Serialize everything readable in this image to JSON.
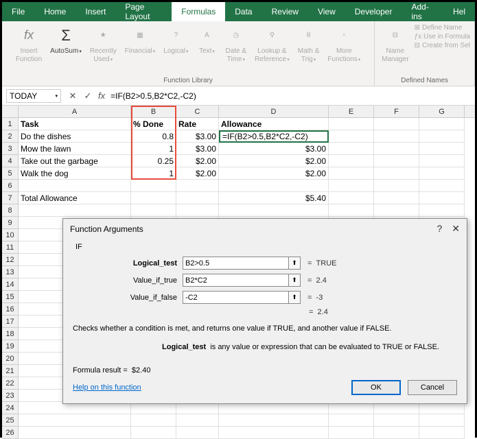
{
  "tabs": [
    "File",
    "Home",
    "Insert",
    "Page Layout",
    "Formulas",
    "Data",
    "Review",
    "View",
    "Developer",
    "Add-ins",
    "Hel"
  ],
  "active_tab": 4,
  "ribbon": {
    "insert_function": "Insert\nFunction",
    "autosum": "AutoSum",
    "recently": "Recently\nUsed",
    "financial": "Financial",
    "logical": "Logical",
    "text": "Text",
    "date_time": "Date &\nTime",
    "lookup": "Lookup &\nReference",
    "math": "Math &\nTrig",
    "more": "More\nFunctions",
    "group1": "Function Library",
    "name_mgr": "Name\nManager",
    "define_name": "Define Name",
    "use_formula": "Use in Formula",
    "create_sel": "Create from Sel",
    "group2": "Defined Names"
  },
  "name_box": "TODAY",
  "formula": "=IF(B2>0.5,B2*C2,-C2)",
  "cols": [
    "A",
    "B",
    "C",
    "D",
    "E",
    "F",
    "G"
  ],
  "headers": {
    "A": "Task",
    "B": "% Done",
    "C": "Rate",
    "D": "Allowance"
  },
  "data_rows": [
    {
      "A": "Do the dishes",
      "B": "0.8",
      "C": "$3.00",
      "D": "=IF(B2>0.5,B2*C2,-C2)",
      "editing": true
    },
    {
      "A": "Mow the lawn",
      "B": "1",
      "C": "$3.00",
      "D": "$3.00"
    },
    {
      "A": "Take out the garbage",
      "B": "0.25",
      "C": "$2.00",
      "D": "$2.00"
    },
    {
      "A": "Walk the dog",
      "B": "1",
      "C": "$2.00",
      "D": "$2.00"
    }
  ],
  "total_row": {
    "A": "Total Allowance",
    "D": "$5.40"
  },
  "chart_data": {
    "type": "table",
    "title": "Allowance calculation",
    "columns": [
      "Task",
      "% Done",
      "Rate",
      "Allowance"
    ],
    "rows": [
      [
        "Do the dishes",
        0.8,
        3.0,
        2.4
      ],
      [
        "Mow the lawn",
        1,
        3.0,
        3.0
      ],
      [
        "Take out the garbage",
        0.25,
        2.0,
        2.0
      ],
      [
        "Walk the dog",
        1,
        2.0,
        2.0
      ]
    ],
    "total_allowance": 5.4,
    "formula_in_D2": "=IF(B2>0.5,B2*C2,-C2)"
  },
  "dialog": {
    "title": "Function Arguments",
    "func": "IF",
    "args": [
      {
        "label": "Logical_test",
        "value": "B2>0.5",
        "result": "TRUE",
        "bold": true
      },
      {
        "label": "Value_if_true",
        "value": "B2*C2",
        "result": "2.4"
      },
      {
        "label": "Value_if_false",
        "value": "-C2",
        "result": "-3"
      }
    ],
    "overall_result": "2.4",
    "desc1": "Checks whether a condition is met, and returns one value if TRUE, and another value if FALSE.",
    "desc2_label": "Logical_test",
    "desc2_text": "is any value or expression that can be evaluated to TRUE or FALSE.",
    "formula_result_label": "Formula result =",
    "formula_result": "$2.40",
    "help": "Help on this function",
    "ok": "OK",
    "cancel": "Cancel"
  }
}
